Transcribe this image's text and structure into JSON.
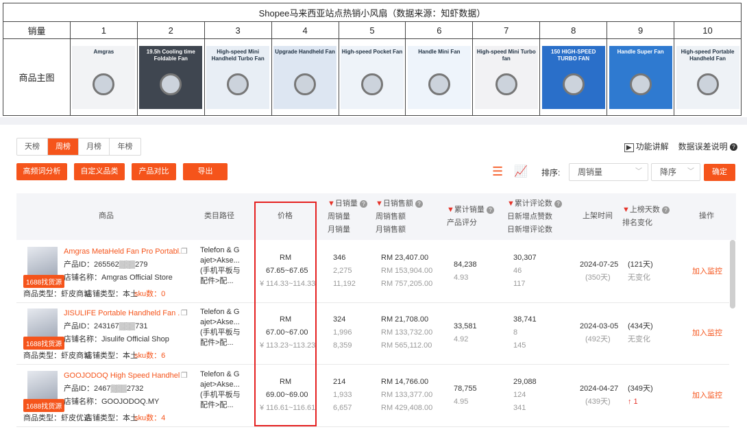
{
  "top_table": {
    "title": "Shopee马来西亚站点热销小风扇（数据来源：知虾数据）",
    "rank_label": "销量",
    "image_label": "商品主图",
    "ranks": [
      "1",
      "2",
      "3",
      "4",
      "5",
      "6",
      "7",
      "8",
      "9",
      "10"
    ],
    "thumbs": [
      {
        "caption": "Amgras",
        "bg": "#f2f3f5"
      },
      {
        "caption": "19.5h Cooling time Foldable Fan",
        "bg": "#3f4650"
      },
      {
        "caption": "High-speed Mini Handheld Turbo Fan",
        "bg": "#e8eef5"
      },
      {
        "caption": "Upgrade Handheld Fan",
        "bg": "#dde6f2"
      },
      {
        "caption": "High-speed Pocket Fan",
        "bg": "#eef3f9"
      },
      {
        "caption": "Handle Mini Fan",
        "bg": "#eef4fb"
      },
      {
        "caption": "High-speed Mini Turbo fan",
        "bg": "#f2f2f4"
      },
      {
        "caption": "150 HIGH-SPEED TURBO FAN",
        "bg": "#2a6fc9"
      },
      {
        "caption": "Handle Super Fan",
        "bg": "#2f7ad0"
      },
      {
        "caption": "High-speed Portable Handheld Fan",
        "bg": "#eef2f6"
      }
    ]
  },
  "tabs": [
    "天榜",
    "周榜",
    "月榜",
    "年榜"
  ],
  "active_tab": "周榜",
  "links": {
    "explain": "功能讲解",
    "error": "数据误差说明"
  },
  "buttons": [
    "高频词分析",
    "自定义品类",
    "产品对比",
    "导出"
  ],
  "sort": {
    "label": "排序:",
    "field": "周销量",
    "order": "降序",
    "confirm": "确定"
  },
  "headers": {
    "product": "商品",
    "category": "类目路径",
    "price": "价格",
    "daily_sales": "日销量",
    "weekly_sales": "周销量",
    "monthly_sales": "月销量",
    "daily_revenue": "日销售额",
    "weekly_revenue": "周销售额",
    "monthly_revenue": "月销售额",
    "total_sales": "累计销量",
    "rating": "产品评分",
    "total_reviews": "累计评论数",
    "new_liked_reviews": "日新增点赞数",
    "new_reviews": "日新增评论数",
    "listed_time": "上架时间",
    "days_on_list": "上榜天数",
    "rank_change": "排名变化",
    "action": "操作"
  },
  "rows": [
    {
      "name": "Amgras MetaHeld Fan Pro Portabl...",
      "id": "产品ID：265562▒▒▒279",
      "shop": "店铺名称：Amgras Official Store",
      "badge": "1688找货源",
      "meta_a": "商品类型：虾皮商城",
      "meta_b": "店铺类型：本土",
      "sku_label": "sku数：",
      "sku": "0",
      "category": [
        "Telefon & G",
        "ajet>Akse...",
        "(手机平板与",
        "配件>配..."
      ],
      "price_cur": "RM",
      "price_rm": "67.65~67.65",
      "price_cny": "¥ 114.33~114.33",
      "sales": [
        "346",
        "2,275",
        "11,192"
      ],
      "revenue": [
        "RM 23,407.00",
        "RM 153,904.00",
        "RM 757,205.00"
      ],
      "total_sales": "84,238",
      "rating": "4.93",
      "reviews": [
        "30,307",
        "46",
        "117"
      ],
      "date": "2024-07-25",
      "date_days": "(350天)",
      "days": "(121天)",
      "change": "无变化",
      "action": "加入监控"
    },
    {
      "name": "JISULIFE Portable Handheld Fan ...",
      "id": "产品ID：243167▒▒▒731",
      "shop": "店铺名称：Jisulife Official Shop",
      "badge": "1688找货源",
      "meta_a": "商品类型：虾皮商城",
      "meta_b": "店铺类型：本土",
      "sku_label": "sku数：",
      "sku": "6",
      "category": [
        "Telefon & G",
        "ajet>Akse...",
        "(手机平板与",
        "配件>配..."
      ],
      "price_cur": "RM",
      "price_rm": "67.00~67.00",
      "price_cny": "¥ 113.23~113.23",
      "sales": [
        "324",
        "1,996",
        "8,359"
      ],
      "revenue": [
        "RM 21,708.00",
        "RM 133,732.00",
        "RM 565,112.00"
      ],
      "total_sales": "33,581",
      "rating": "4.92",
      "reviews": [
        "38,741",
        "8",
        "145"
      ],
      "date": "2024-03-05",
      "date_days": "(492天)",
      "days": "(434天)",
      "change": "无变化",
      "action": "加入监控"
    },
    {
      "name": "GOOJODOQ High Speed Handhel...",
      "id": "产品ID：2467▒▒▒2732",
      "shop": "店铺名称：GOOJODOQ.MY",
      "badge": "1688找货源",
      "meta_a": "商品类型：虾皮优选",
      "meta_b": "店铺类型：本土",
      "sku_label": "sku数：",
      "sku": "4",
      "category": [
        "Telefon & G",
        "ajet>Akse...",
        "(手机平板与",
        "配件>配..."
      ],
      "price_cur": "RM",
      "price_rm": "69.00~69.00",
      "price_cny": "¥ 116.61~116.61",
      "sales": [
        "214",
        "1,933",
        "6,657"
      ],
      "revenue": [
        "RM 14,766.00",
        "RM 133,377.00",
        "RM 429,408.00"
      ],
      "total_sales": "78,755",
      "rating": "4.95",
      "reviews": [
        "29,088",
        "124",
        "341"
      ],
      "date": "2024-04-27",
      "date_days": "(439天)",
      "days": "(349天)",
      "change": "↑ 1",
      "action": "加入监控"
    }
  ],
  "colors": {
    "accent": "#f5541b",
    "highlight_box": "#e51f1f"
  }
}
